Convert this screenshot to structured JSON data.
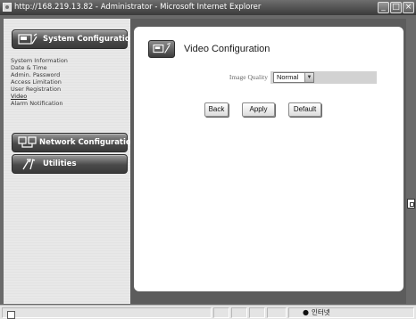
{
  "window": {
    "title": "http://168.219.13.82 - Administrator - Microsoft Internet Explorer",
    "buttons": [
      "_",
      "□",
      "×"
    ]
  },
  "sidebar": {
    "system_config": "System Configuration",
    "items": [
      {
        "label": "System Information",
        "active": false
      },
      {
        "label": "Date & Time",
        "active": false
      },
      {
        "label": "Admin. Password",
        "active": false
      },
      {
        "label": "Access Limitation",
        "active": false
      },
      {
        "label": "User Registration",
        "active": false
      },
      {
        "label": "Video",
        "active": true
      },
      {
        "label": "Alarm Notification",
        "active": false
      }
    ],
    "network_config": "Network Configuration",
    "utilities": "Utilities"
  },
  "main": {
    "title": "Video Configuration",
    "image_quality_label": "Image Quality",
    "image_quality_value": "Normal",
    "buttons": {
      "back": "Back",
      "apply": "Apply",
      "default": "Default"
    }
  },
  "statusbar": {
    "zone": "인터넷"
  },
  "icons": {
    "system": "settings-panel-icon",
    "network": "network-computers-icon",
    "utilities": "tools-icon",
    "page": "video-settings-icon",
    "zone": "globe-icon"
  },
  "colors": {
    "frame": "#6a6a6a",
    "nav_button": "#4a4a4a",
    "panel": "#ffffff",
    "sidebar": "#e8e8e8"
  }
}
